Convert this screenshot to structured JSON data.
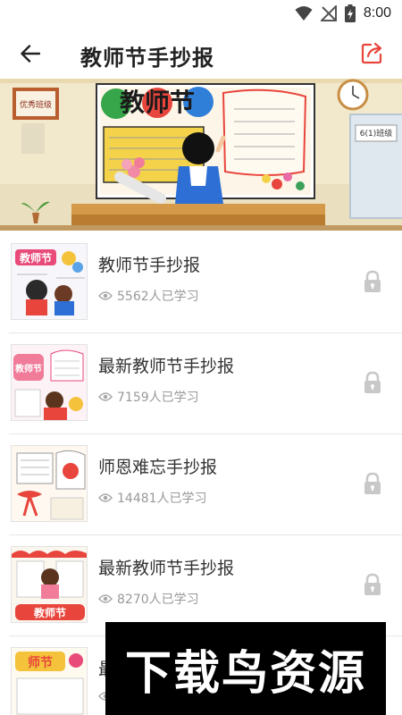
{
  "status_bar": {
    "time": "8:00",
    "icons": [
      "wifi-icon",
      "no-signal-icon",
      "battery-charging-icon"
    ]
  },
  "header": {
    "title": "教师节手抄报",
    "back_icon": "arrow-left-icon",
    "share_icon": "share-icon"
  },
  "banner": {
    "poster_title": "教师节",
    "plaque_text": "优秀班级",
    "door_sign": "6(1)班级"
  },
  "courses": [
    {
      "title": "教师节手抄报",
      "learners": "5562人已学习",
      "locked": true,
      "thumb_text": "教师节"
    },
    {
      "title": "最新教师节手抄报",
      "learners": "7159人已学习",
      "locked": true,
      "thumb_text": "教师节"
    },
    {
      "title": "师恩难忘手抄报",
      "learners": "14481人已学习",
      "locked": true,
      "thumb_text": ""
    },
    {
      "title": "最新教师节手抄报",
      "learners": "8270人已学习",
      "locked": true,
      "thumb_text": "教师节"
    },
    {
      "title": "最",
      "learners": "",
      "locked": true,
      "thumb_text": "师节"
    }
  ],
  "watermark": {
    "text": "下载鸟资源"
  },
  "colors": {
    "accent": "#e8453c",
    "text": "#333333",
    "meta": "#999999",
    "lock": "#c8c8c8"
  }
}
